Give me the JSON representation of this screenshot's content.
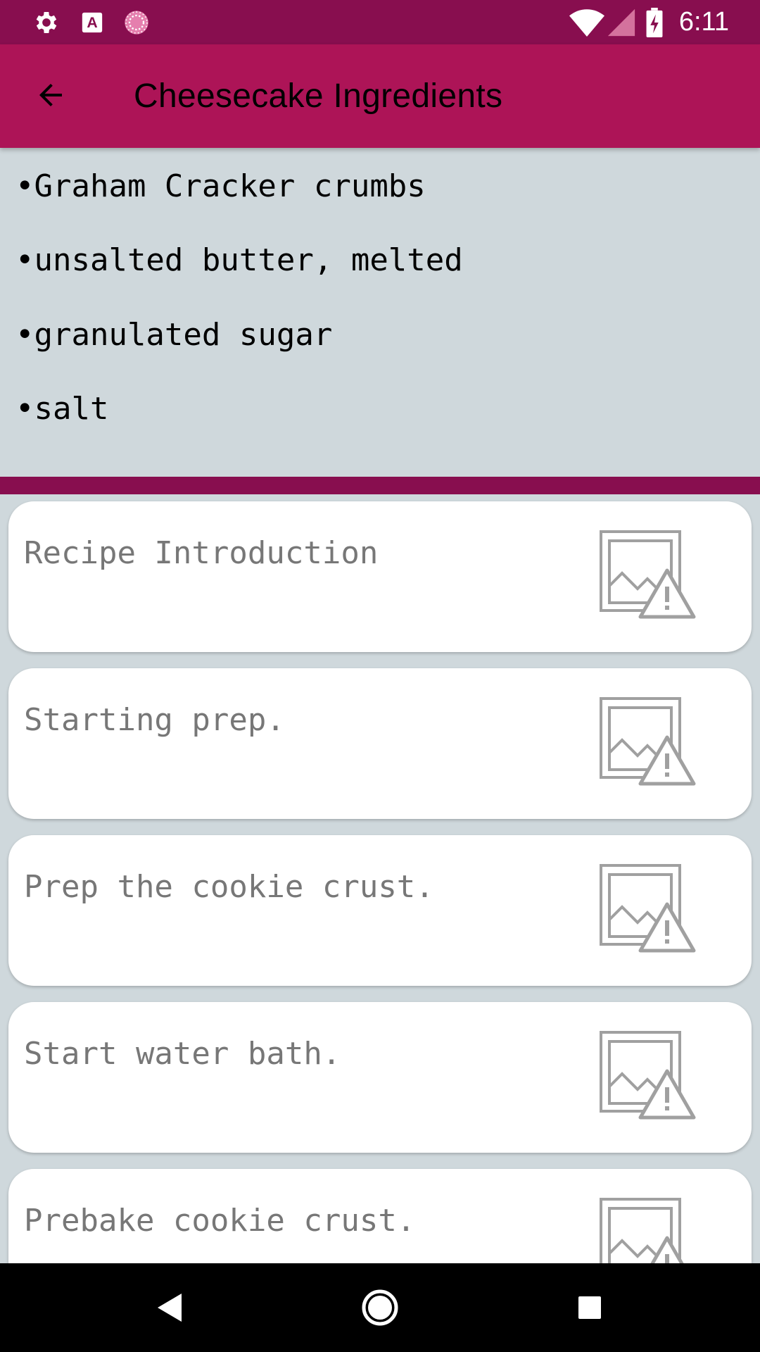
{
  "status_bar": {
    "time": "6:11",
    "icons": [
      "settings-icon",
      "text-a-icon",
      "sync-circle-icon",
      "wifi-icon",
      "signal-icon",
      "battery-charging-icon"
    ]
  },
  "app_bar": {
    "title": "Cheesecake Ingredients",
    "back_icon": "arrow-back-icon"
  },
  "ingredients": [
    "•Graham Cracker crumbs",
    "•unsalted butter, melted",
    "•granulated sugar",
    "•salt"
  ],
  "steps": [
    {
      "label": "Recipe Introduction",
      "image_icon": "broken-image-icon"
    },
    {
      "label": "Starting prep.",
      "image_icon": "broken-image-icon"
    },
    {
      "label": "Prep the cookie crust.",
      "image_icon": "broken-image-icon"
    },
    {
      "label": "Start water bath.",
      "image_icon": "broken-image-icon"
    },
    {
      "label": "Prebake cookie crust.",
      "image_icon": "broken-image-icon"
    }
  ],
  "nav_bar": {
    "buttons": [
      "nav-back-icon",
      "nav-home-icon",
      "nav-recents-icon"
    ]
  },
  "colors": {
    "status_bar": "#880e4f",
    "app_bar": "#ad1457",
    "background": "#cfd8dc",
    "card": "#ffffff",
    "step_text": "#777777"
  }
}
